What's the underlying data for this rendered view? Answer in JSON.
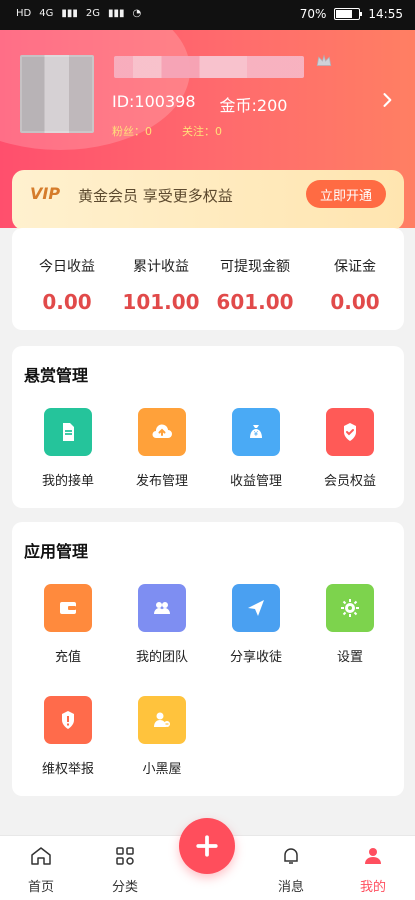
{
  "statusbar": {
    "battery": "70%",
    "time": "14:55",
    "net1": "4G",
    "net2": "2G"
  },
  "profile": {
    "id_text": "ID:100398",
    "coins_text": "金币:200",
    "fans_text": "粉丝：0",
    "follows_text": "关注：0"
  },
  "vip": {
    "badge": "VIP",
    "text": "黄金会员 享受更多权益",
    "button": "立即开通",
    "progress": 0.7
  },
  "earnings": {
    "items": [
      {
        "label": "今日收益",
        "value": "0.00"
      },
      {
        "label": "累计收益",
        "value": "101.00"
      },
      {
        "label": "可提现金额",
        "value": "601.00"
      },
      {
        "label": "保证金",
        "value": "0.00"
      }
    ]
  },
  "bounty_section": {
    "title": "悬赏管理",
    "items": [
      {
        "label": "我的接单",
        "icon": "document-icon",
        "color": "#25c49b"
      },
      {
        "label": "发布管理",
        "icon": "cloud-upload-icon",
        "color": "#ffa13a"
      },
      {
        "label": "收益管理",
        "icon": "money-bag-icon",
        "color": "#4aaaf5"
      },
      {
        "label": "会员权益",
        "icon": "member-badge-icon",
        "color": "#ff5a57"
      }
    ]
  },
  "app_section": {
    "title": "应用管理",
    "items": [
      {
        "label": "充值",
        "icon": "wallet-icon",
        "color": "#ff8a3d"
      },
      {
        "label": "我的团队",
        "icon": "team-icon",
        "color": "#7e8ef2"
      },
      {
        "label": "分享收徒",
        "icon": "paper-plane-icon",
        "color": "#4aa0f1"
      },
      {
        "label": "设置",
        "icon": "gear-icon",
        "color": "#7dd34d"
      },
      {
        "label": "维权举报",
        "icon": "shield-alert-icon",
        "color": "#ff6b4b"
      },
      {
        "label": "小黑屋",
        "icon": "user-block-icon",
        "color": "#ffc33d"
      }
    ]
  },
  "tabbar": {
    "tabs": [
      {
        "label": "首页",
        "icon": "home-icon"
      },
      {
        "label": "分类",
        "icon": "grid-icon"
      },
      {
        "label": "消息",
        "icon": "bell-icon"
      },
      {
        "label": "我的",
        "icon": "user-icon",
        "active": true
      }
    ],
    "plus_icon": "plus-icon"
  }
}
